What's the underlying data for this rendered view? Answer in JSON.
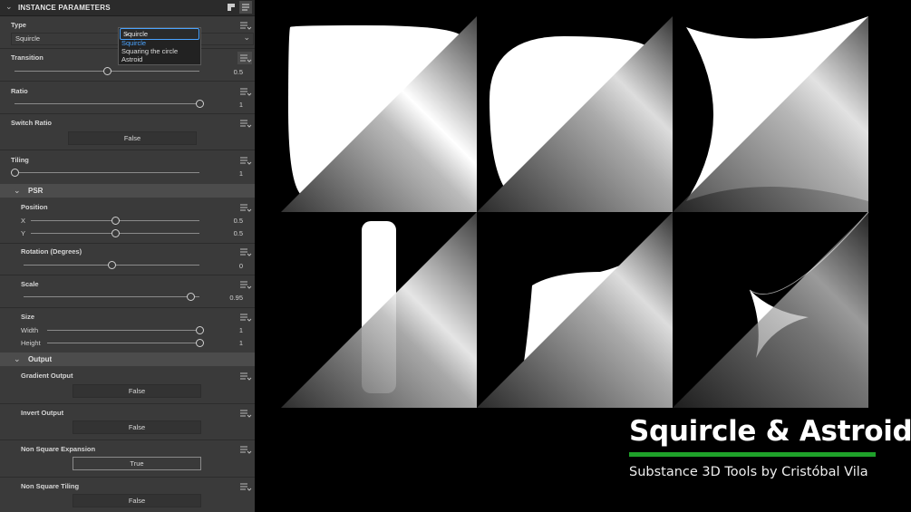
{
  "panel": {
    "title": "INSTANCE PARAMETERS",
    "type": {
      "label": "Type",
      "value": "Squircle",
      "dropdown": {
        "selected": "Squircle",
        "options": [
          "Squircle",
          "Squaring the circle",
          "Astroid"
        ],
        "highlighted": "Squircle"
      }
    },
    "transition": {
      "label": "Transition",
      "value": "0.5",
      "fraction": 0.5
    },
    "ratio": {
      "label": "Ratio",
      "value": "1",
      "fraction": 1.0
    },
    "switch_ratio": {
      "label": "Switch Ratio",
      "value": "False"
    },
    "tiling": {
      "label": "Tiling",
      "value": "1",
      "fraction": 0.0
    },
    "psr": {
      "label": "PSR",
      "position": {
        "label": "Position",
        "x": {
          "label": "X",
          "value": "0.5",
          "fraction": 0.5
        },
        "y": {
          "label": "Y",
          "value": "0.5",
          "fraction": 0.5
        }
      },
      "rotation": {
        "label": "Rotation (Degrees)",
        "value": "0",
        "fraction": 0.5
      },
      "scale": {
        "label": "Scale",
        "value": "0.95",
        "fraction": 0.95
      },
      "size": {
        "label": "Size",
        "width": {
          "label": "Width",
          "value": "1",
          "fraction": 1.0
        },
        "height": {
          "label": "Height",
          "value": "1",
          "fraction": 1.0
        }
      }
    },
    "output": {
      "label": "Output",
      "gradient_output": {
        "label": "Gradient Output",
        "value": "False"
      },
      "invert_output": {
        "label": "Invert Output",
        "value": "False"
      },
      "non_square_expansion": {
        "label": "Non Square Expansion",
        "value": "True"
      },
      "non_square_tiling": {
        "label": "Non Square Tiling",
        "value": "False"
      }
    }
  },
  "artwork": {
    "title": "Squircle & Astroid",
    "byline": "Substance 3D Tools by Cristóbal Vila",
    "accent_color": "#1fa12a"
  },
  "icons": [
    "chevron-down-icon",
    "pin-icon",
    "list-menu-icon",
    "parameter-menu-icon"
  ]
}
